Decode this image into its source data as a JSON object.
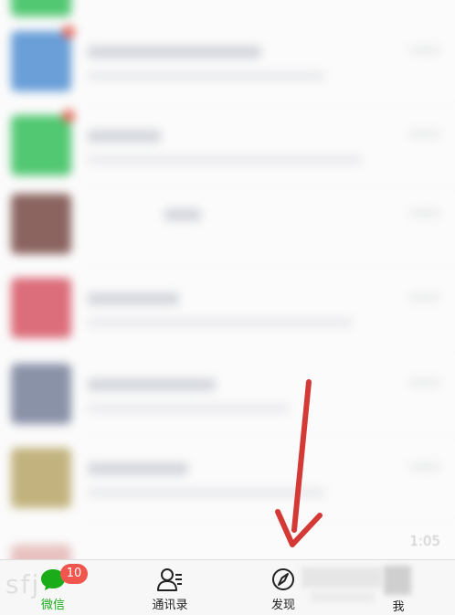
{
  "chat_list": {
    "rows": [
      {
        "avatar_color": "#6a9fd8",
        "title_width": 190,
        "msg_width": 260,
        "unread": true
      },
      {
        "avatar_color": "#52c873",
        "title_width": 80,
        "msg_width": 300,
        "unread": true
      },
      {
        "avatar_color": "#8b6460",
        "title_width": 40,
        "msg_width": 0,
        "unread": false
      },
      {
        "avatar_color": "#dc6d7a",
        "title_width": 100,
        "msg_width": 290,
        "unread": false
      },
      {
        "avatar_color": "#8a92a8",
        "title_width": 140,
        "msg_width": 220,
        "unread": false
      },
      {
        "avatar_color": "#c2b37e",
        "title_width": 110,
        "msg_width": 260,
        "unread": false
      }
    ],
    "faint_time": "1:05"
  },
  "tabbar": {
    "tabs": [
      {
        "id": "chats",
        "label": "微信",
        "active": true,
        "badge": "10"
      },
      {
        "id": "contacts",
        "label": "通讯录",
        "active": false
      },
      {
        "id": "discover",
        "label": "发现",
        "active": false
      },
      {
        "id": "me",
        "label": "我",
        "active": false
      }
    ],
    "watermark": "sfj"
  },
  "colors": {
    "accent": "#1aad19",
    "badge": "#f0564d",
    "arrow": "#d33a36"
  }
}
